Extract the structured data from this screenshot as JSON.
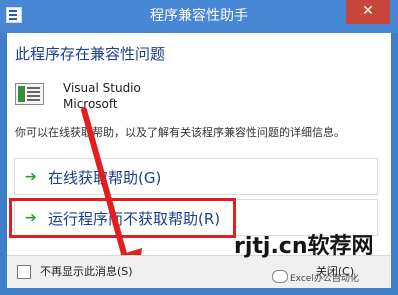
{
  "window": {
    "title": "程序兼容性助手",
    "close_glyph": "✕"
  },
  "main": {
    "heading": "此程序存在兼容性问题",
    "program_name_line1": "Visual Studio",
    "program_name_line2": "Microsoft",
    "info_text": "你可以在线获取帮助，以及了解有关该程序兼容性问题的详细信息。",
    "options": [
      {
        "icon": "green-arrow-icon",
        "label": "在线获取帮助(G)"
      },
      {
        "icon": "green-arrow-icon",
        "label": "运行程序而不获取帮助(R)"
      }
    ]
  },
  "footer": {
    "checkbox_label": "不再显示此消息(S)",
    "close_label": "关闭(C)"
  },
  "overlay": {
    "watermark": "rjtj.cn软荐网",
    "watermark_sub": "Excel办公自动化",
    "accent_red": "#e21f1f"
  }
}
